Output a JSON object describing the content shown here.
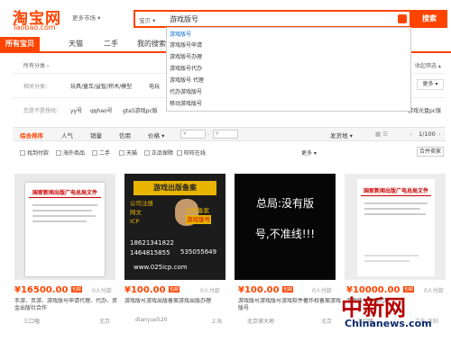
{
  "header": {
    "logo": "淘宝网",
    "logo_sub": "Taobao.com",
    "market_label": "更多市场 ▾",
    "search_category": "宝贝 ▾",
    "search_query": "游戏版号",
    "search_button": "搜索"
  },
  "suggestions": [
    "游戏版号",
    "游戏版号申请",
    "游戏版号办理",
    "游戏版号代办",
    "游戏版号 代理",
    "代办游戏版号",
    "移动游戏版号"
  ],
  "tabs": [
    "所有宝贝",
    "天猫",
    "二手",
    "我的搜索"
  ],
  "nav": {
    "collapse": "收起筛选 ▴"
  },
  "filters": {
    "all_label": "所有分类 ›",
    "related_label": "相关分类：",
    "related_items": [
      "玩具/童车/益智/积木/模型",
      "电玩"
    ],
    "more": "更多 ▾",
    "guess_label": "您是不是想找：",
    "guess_items": [
      "yy号",
      "qqhao号",
      "gta5游戏pc版"
    ],
    "guess_tail": "游戏光盘pc版"
  },
  "sortbar": {
    "items": [
      "综合排序",
      "人气",
      "销量",
      "信用",
      "价格 ▾"
    ],
    "price_from": "¥",
    "price_to": "¥",
    "ship": "发货地 ▾",
    "pager": "1/100"
  },
  "checkboxes": [
    "找到付款",
    "海外商品",
    "二手",
    "天猫",
    "正品保障",
    "旺旺在线"
  ],
  "more2": "更多 ▾",
  "merge": "合并卖家",
  "cards": [
    {
      "price": "¥16500.00",
      "badge": "包邮",
      "buyers": "0人付款",
      "title": "手游、页游、游戏版号申请代理、代办、资金出版社合作",
      "shop": "三口嗑",
      "loc": "北京",
      "doc_heading": "国家新闻出版广电总局文件"
    },
    {
      "price": "¥100.00",
      "badge": "包邮",
      "buyers": "0人付款",
      "title": "游戏版号游戏出版备案游戏出版办理",
      "shop": "dianyue520",
      "loc": "上海",
      "poster_title": "游戏出版备案",
      "poster_items": [
        "公司注册",
        "运营备案",
        "网文",
        "游戏版号",
        "ICP"
      ],
      "poster_phones": [
        "18621341822",
        "1464815855",
        "535055649"
      ],
      "poster_url": "www.025icp.com"
    },
    {
      "price": "¥100.00",
      "badge": "包邮",
      "buyers": "0人付款",
      "title": "游戏版号游戏版号游戏软件著作权备案游戏版号",
      "shop": "北京律大地",
      "loc": "北京",
      "slogan_1": "总局:没有版",
      "slogan_2": "号,不准线!!!"
    },
    {
      "price": "¥10000.00",
      "badge": "包邮",
      "buyers": "0人付款",
      "title": "游戏版号申请代理",
      "shop": "三口嗑",
      "loc": "广东 深圳",
      "doc_heading": "国家新闻出版广电总局文件"
    }
  ],
  "watermark": {
    "cn": "中新网",
    "en": "Chinanews.com"
  }
}
